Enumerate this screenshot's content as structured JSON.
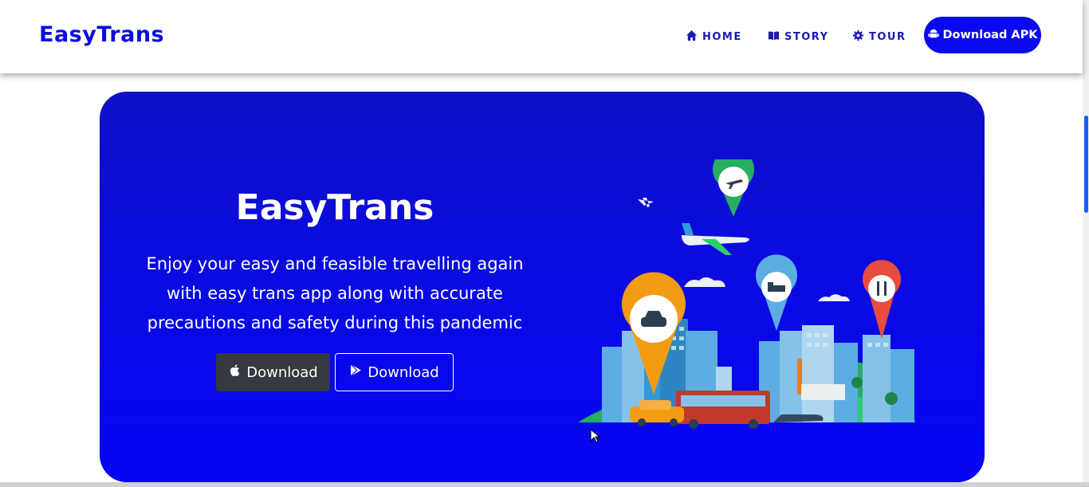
{
  "navbar": {
    "brand": "EasyTrans",
    "links": [
      {
        "label": "HOME",
        "icon": "home-icon"
      },
      {
        "label": "STORY",
        "icon": "book-icon"
      },
      {
        "label": "TOUR",
        "icon": "gear-icon"
      }
    ],
    "apk_button": {
      "label": "Download APK",
      "icon": "android-icon"
    }
  },
  "hero": {
    "title": "EasyTrans",
    "description": "Enjoy your easy and feasible travelling again with easy trans app along with accurate precautions and safety during this pandemic",
    "buttons": [
      {
        "label": "Download",
        "icon": "apple-icon"
      },
      {
        "label": "Download",
        "icon": "play-store-icon"
      }
    ]
  },
  "colors": {
    "brand": "#0a0ae6",
    "hero_background": "#0a0ae6",
    "apple_button": "#343a40"
  }
}
